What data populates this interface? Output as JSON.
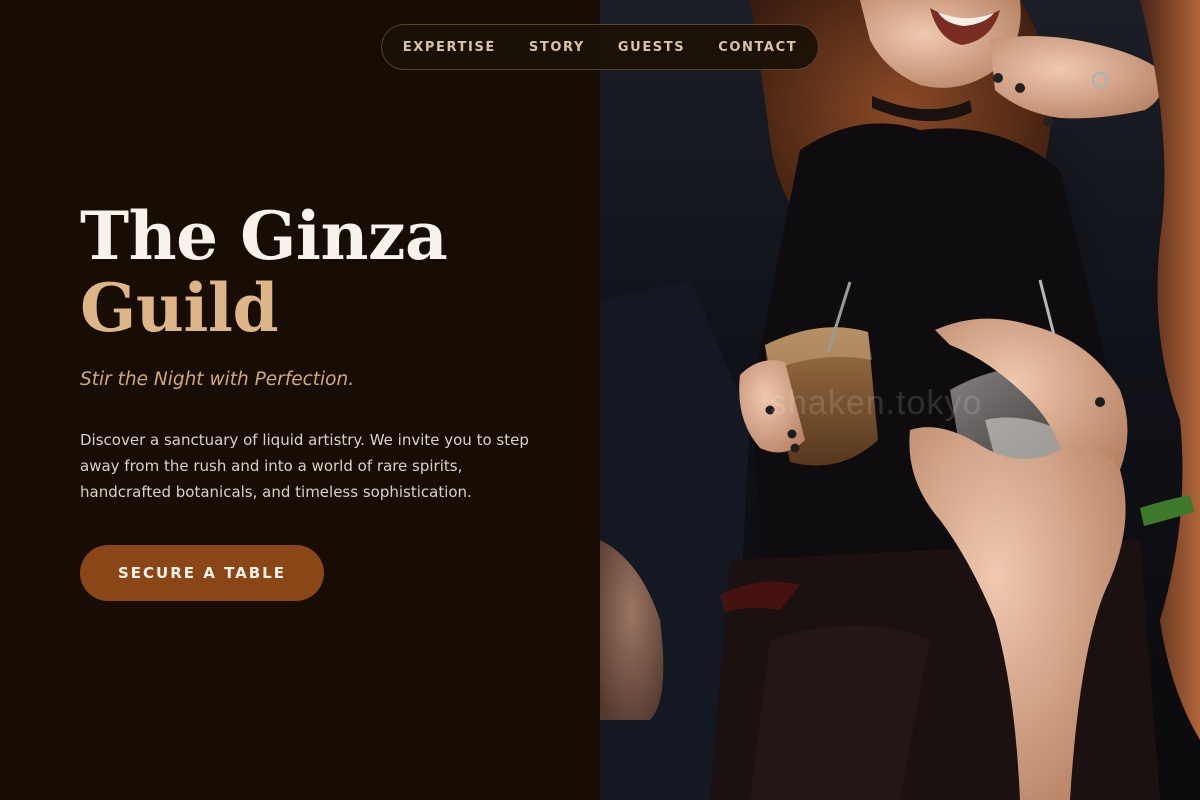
{
  "nav": {
    "items": [
      {
        "label": "EXPERTISE"
      },
      {
        "label": "STORY"
      },
      {
        "label": "GUESTS"
      },
      {
        "label": "CONTACT"
      }
    ]
  },
  "hero": {
    "title_line1": "The Ginza",
    "title_line2": "Guild",
    "tagline": "Stir the Night with Perfection.",
    "intro": "Discover a sanctuary of liquid artistry. We invite you to step away from the rush and into a world of rare spirits, handcrafted botanicals, and timeless sophistication.",
    "cta_label": "SECURE A TABLE"
  },
  "photo": {
    "watermark": "shaken.tokyo"
  },
  "colors": {
    "background": "#170d04",
    "title_primary": "#f7f2ea",
    "title_accent": "#ddb587",
    "tagline": "#d3a878",
    "cta_background": "#8a4616",
    "nav_text": "#d9c4a6"
  }
}
